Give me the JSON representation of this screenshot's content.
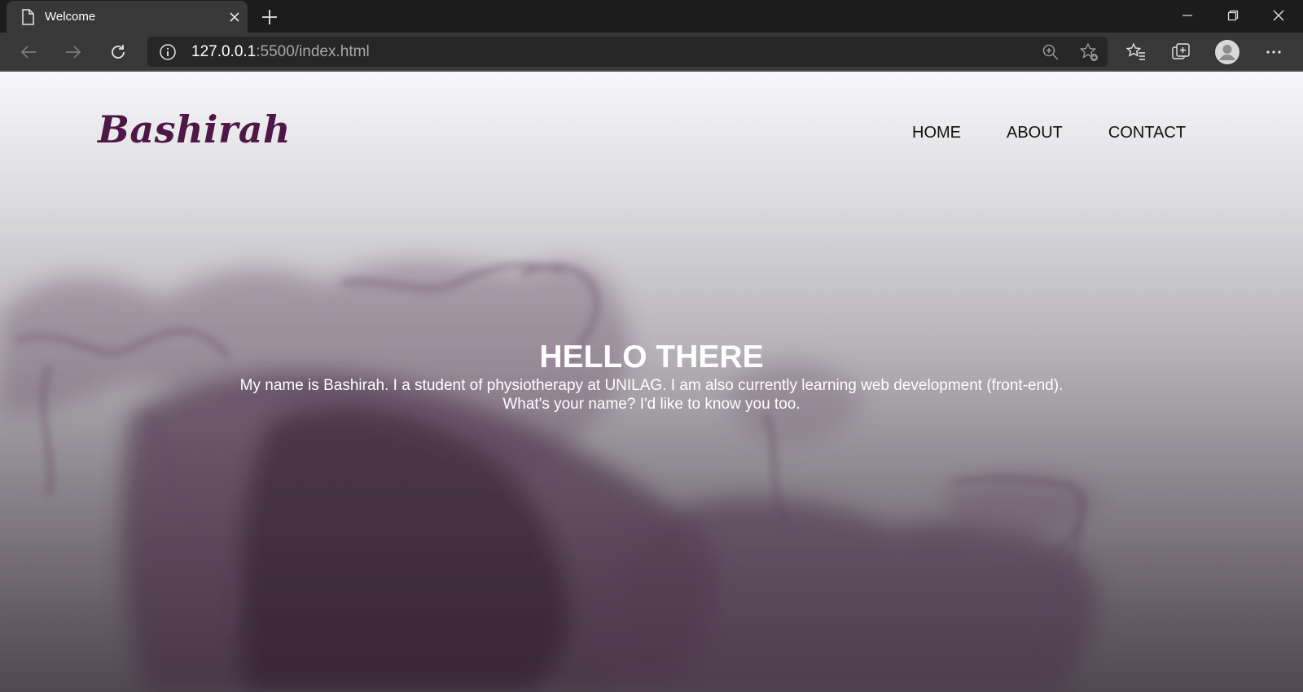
{
  "browser": {
    "tab": {
      "title": "Welcome"
    },
    "address": {
      "host": "127.0.0.1",
      "rest": ":5500/index.html"
    }
  },
  "site": {
    "logo": "Bashirah",
    "nav": [
      {
        "label": "HOME"
      },
      {
        "label": "ABOUT"
      },
      {
        "label": "CONTACT"
      }
    ],
    "hero": {
      "title": "HELLO THERE",
      "line1": "My name is Bashirah. I a student of physiotherapy at UNILAG. I am also currently learning web development (front-end).",
      "line2": "What's your name? I'd like to know you too."
    }
  },
  "icons": {
    "tab": "page-icon",
    "close": "close-icon",
    "new_tab": "plus-icon",
    "back": "arrow-left-icon",
    "forward": "arrow-right-icon",
    "reload": "reload-icon",
    "info": "info-icon",
    "zoom": "zoom-in-icon",
    "add_favorite": "star-add-icon",
    "favorites": "favorites-icon",
    "collections": "collections-icon",
    "profile": "avatar-icon",
    "more": "more-icon"
  },
  "colors": {
    "logo": "#4e1748",
    "smoke": "#6d4a6b",
    "chrome_dark": "#1c1c1c",
    "chrome_toolbar": "#383838"
  }
}
